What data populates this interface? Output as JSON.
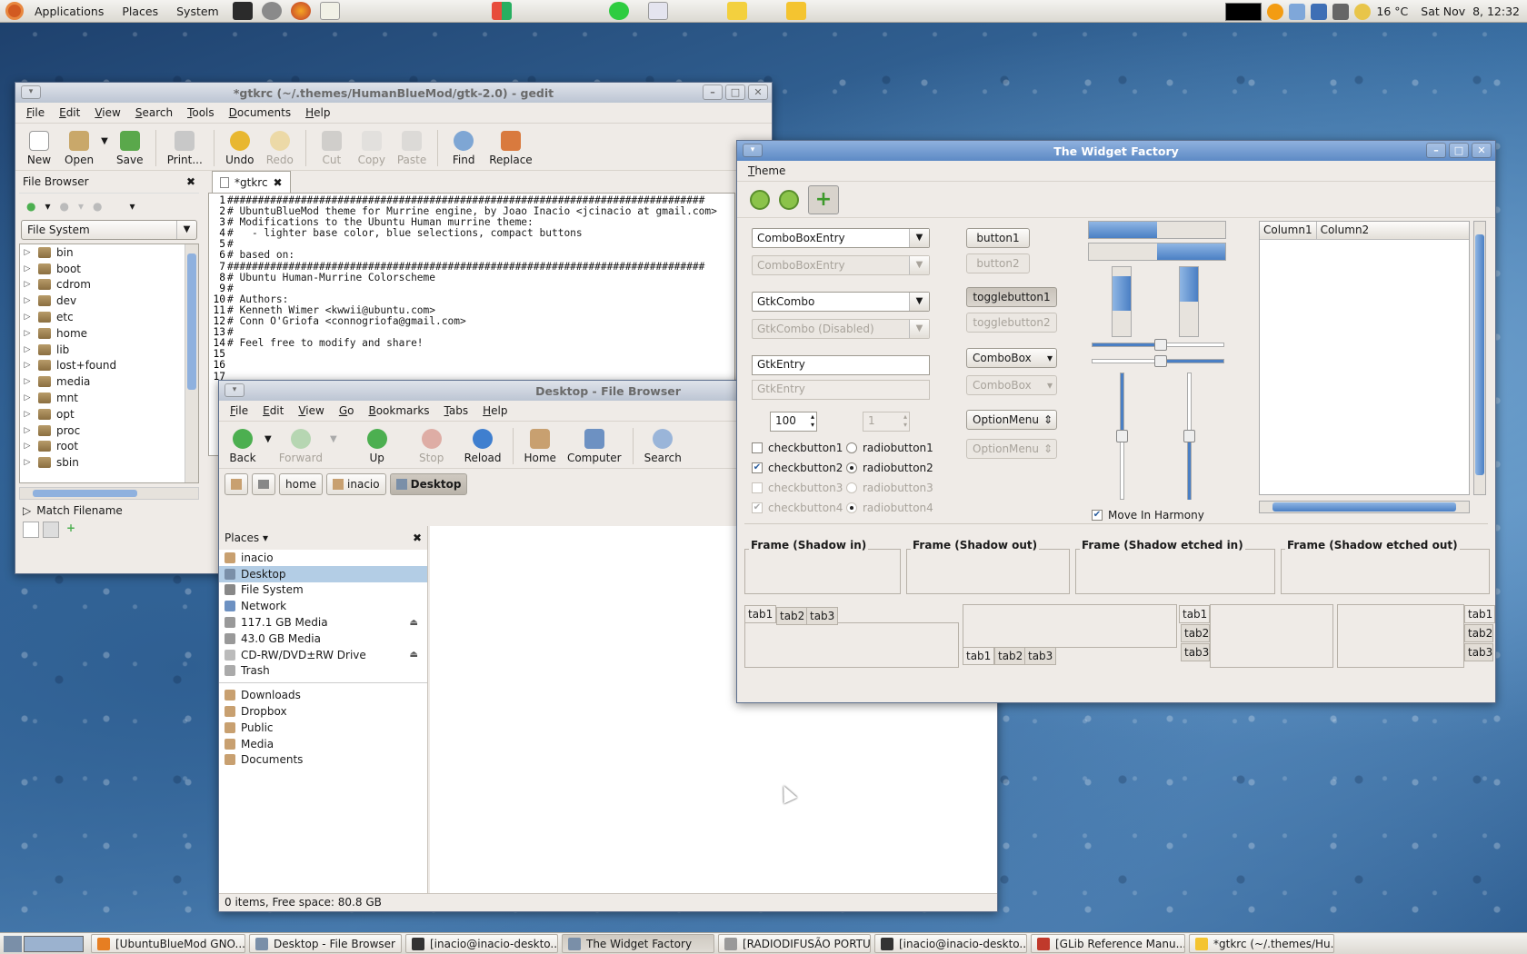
{
  "top_panel": {
    "menus": [
      "Applications",
      "Places",
      "System"
    ],
    "weather": "16 °C",
    "clock": "Sat Nov  8, 12:32"
  },
  "gedit": {
    "title": "*gtkrc (~/.themes/HumanBlueMod/gtk-2.0) - gedit",
    "menu": [
      "File",
      "Edit",
      "View",
      "Search",
      "Tools",
      "Documents",
      "Help"
    ],
    "toolbar": {
      "new": "New",
      "open": "Open",
      "save": "Save",
      "print": "Print...",
      "undo": "Undo",
      "redo": "Redo",
      "cut": "Cut",
      "copy": "Copy",
      "paste": "Paste",
      "find": "Find",
      "replace": "Replace"
    },
    "side_title": "File Browser",
    "filesystem": "File System",
    "folders": [
      "bin",
      "boot",
      "cdrom",
      "dev",
      "etc",
      "home",
      "lib",
      "lost+found",
      "media",
      "mnt",
      "opt",
      "proc",
      "root",
      "sbin"
    ],
    "match_filename": "Match Filename",
    "tab": "*gtkrc",
    "lines": [
      "##############################################################################",
      "# UbuntuBlueMod theme for Murrine engine, by Joao Inacio <jcinacio at gmail.com>",
      "# Modifications to the Ubuntu Human murrine theme:",
      "#   - lighter base color, blue selections, compact buttons",
      "#",
      "# based on:",
      "##############################################################################",
      "# Ubuntu Human-Murrine Colorscheme",
      "#",
      "# Authors:",
      "# Kenneth Wimer <kwwii@ubuntu.com>",
      "# Conn O'Griofa <connogriofa@gmail.com>",
      "#",
      "# Feel free to modify and share!",
      "",
      "",
      ""
    ]
  },
  "filebrowser": {
    "title": "Desktop - File Browser",
    "menu": [
      "File",
      "Edit",
      "View",
      "Go",
      "Bookmarks",
      "Tabs",
      "Help"
    ],
    "toolbar": {
      "back": "Back",
      "forward": "Forward",
      "up": "Up",
      "stop": "Stop",
      "reload": "Reload",
      "home": "Home",
      "computer": "Computer",
      "search": "Search"
    },
    "path": [
      "home",
      "inacio",
      "Desktop"
    ],
    "places_label": "Places",
    "places": [
      "inacio",
      "Desktop",
      "File System",
      "Network",
      "117.1 GB Media",
      "43.0 GB Media",
      "CD-RW/DVD±RW Drive",
      "Trash"
    ],
    "bookmarks": [
      "Downloads",
      "Dropbox",
      "Public",
      "Media",
      "Documents"
    ],
    "status": "0 items, Free space: 80.8 GB"
  },
  "widget_factory": {
    "title": "The Widget Factory",
    "menu": [
      "Theme"
    ],
    "combo_entry": "ComboBoxEntry",
    "combo_entry_dis": "ComboBoxEntry",
    "gtkcombo": "GtkCombo",
    "gtkcombo_dis": "GtkCombo (Disabled)",
    "entry": "GtkEntry",
    "entry_dis": "GtkEntry",
    "spin": "100",
    "spin_dis": "1",
    "checks": [
      "checkbutton1",
      "checkbutton2",
      "checkbutton3",
      "checkbutton4"
    ],
    "radios": [
      "radiobutton1",
      "radiobutton2",
      "radiobutton3",
      "radiobutton4"
    ],
    "buttons": [
      "button1",
      "button2",
      "togglebutton1",
      "togglebutton2",
      "ComboBox",
      "ComboBox",
      "OptionMenu",
      "OptionMenu"
    ],
    "move_in_harmony": "Move In Harmony",
    "columns": [
      "Column1",
      "Column2"
    ],
    "frames": [
      "Frame (Shadow in)",
      "Frame (Shadow out)",
      "Frame (Shadow etched in)",
      "Frame (Shadow etched out)"
    ],
    "tabs": [
      "tab1",
      "tab2",
      "tab3"
    ]
  },
  "taskbar": [
    "[UbuntuBlueMod GNO...",
    "Desktop - File Browser",
    "[inacio@inacio-deskto...",
    "The Widget Factory",
    "[RADIODIFUSÃO PORTU...",
    "[inacio@inacio-deskto...",
    "[GLib Reference Manu...",
    "*gtkrc (~/.themes/Hu..."
  ]
}
